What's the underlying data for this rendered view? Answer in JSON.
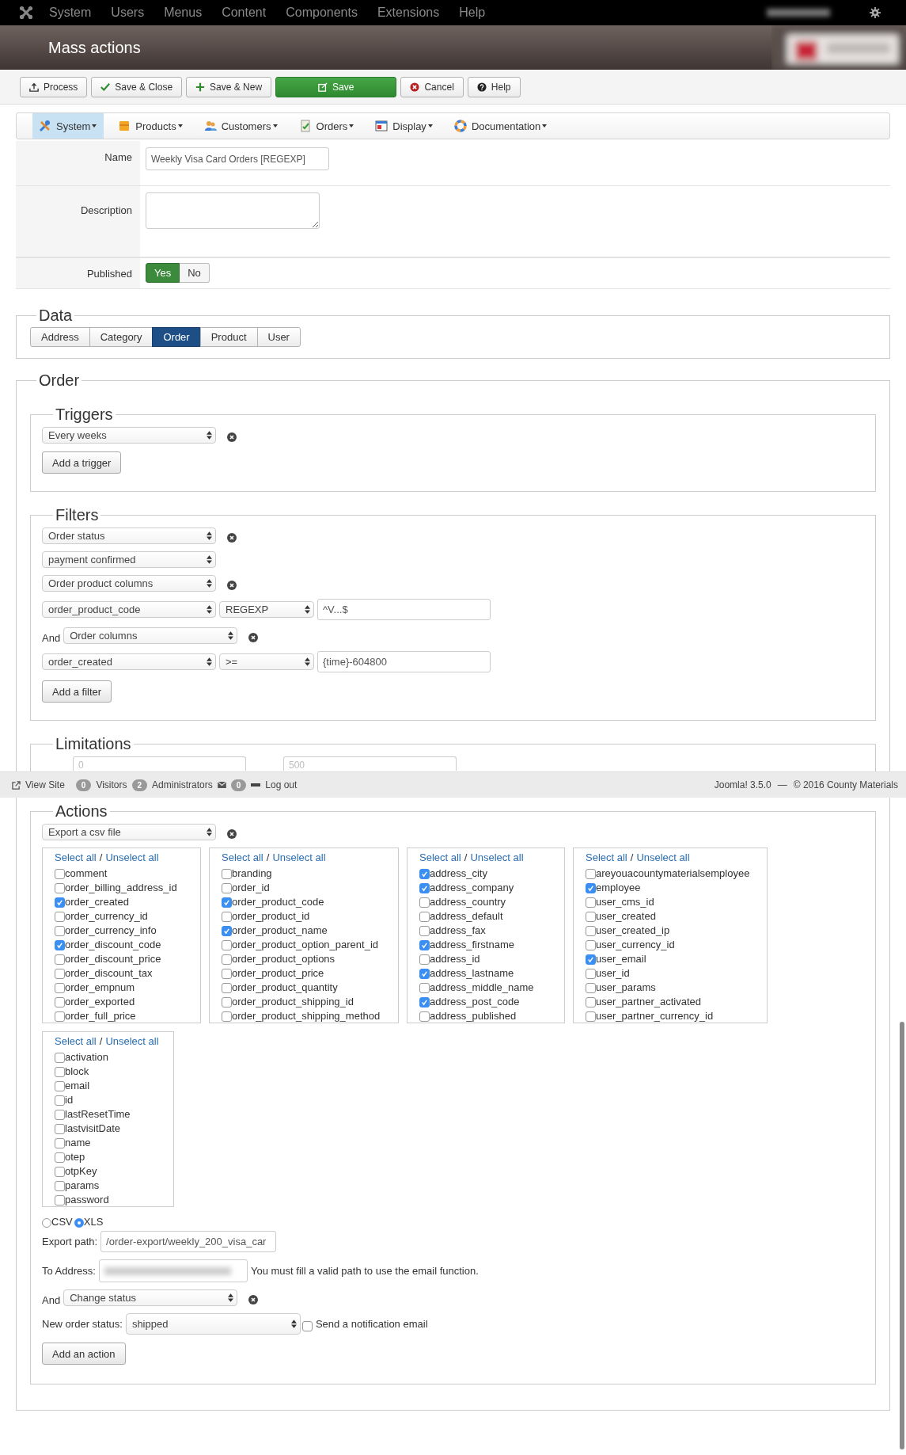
{
  "top_menu": {
    "items": [
      "System",
      "Users",
      "Menus",
      "Content",
      "Components",
      "Extensions",
      "Help"
    ]
  },
  "header": {
    "title": "Mass actions"
  },
  "toolbar": {
    "buttons": [
      {
        "label": "Process",
        "primary": false
      },
      {
        "label": "Save & Close",
        "primary": false
      },
      {
        "label": "Save & New",
        "primary": false
      },
      {
        "label": "Save",
        "primary": true
      },
      {
        "label": "Cancel",
        "primary": false
      },
      {
        "label": "Help",
        "primary": false
      }
    ]
  },
  "submenu": {
    "items": [
      {
        "label": "System",
        "selected": true
      },
      {
        "label": "Products",
        "selected": false
      },
      {
        "label": "Customers",
        "selected": false
      },
      {
        "label": "Orders",
        "selected": false
      },
      {
        "label": "Display",
        "selected": false
      },
      {
        "label": "Documentation",
        "selected": false
      }
    ]
  },
  "form": {
    "name": {
      "label": "Name",
      "value": "Weekly Visa Card Orders [REGEXP]"
    },
    "description": {
      "label": "Description"
    },
    "published": {
      "label": "Published",
      "options": [
        {
          "label": "Yes",
          "selected": true
        },
        {
          "label": "No",
          "selected": false
        }
      ]
    }
  },
  "data": {
    "legend": "Data",
    "tabs": [
      {
        "label": "Address",
        "selected": false
      },
      {
        "label": "Category",
        "selected": false
      },
      {
        "label": "Order",
        "selected": true
      },
      {
        "label": "Product",
        "selected": false
      },
      {
        "label": "User",
        "selected": false
      }
    ]
  },
  "order": {
    "legend": "Order",
    "triggers": {
      "legend": "Triggers",
      "rows": [
        [
          {
            "kind": "select",
            "text": "Every weeks"
          },
          {
            "kind": "remove"
          }
        ]
      ],
      "add_button": "Add a trigger"
    },
    "filters": {
      "legend": "Filters",
      "rows": [
        {
          "controls": [
            {
              "kind": "select",
              "text": "Order status"
            },
            {
              "kind": "remove"
            }
          ]
        },
        {
          "controls": [
            {
              "kind": "select",
              "text": "payment confirmed"
            }
          ]
        },
        {
          "controls": [
            {
              "kind": "select",
              "text": "Order product columns"
            },
            {
              "kind": "remove"
            }
          ]
        },
        {
          "controls": [
            {
              "kind": "select",
              "text": "order_product_code"
            },
            {
              "kind": "operator",
              "text": "REGEXP"
            },
            {
              "kind": "input",
              "text": "^V...$"
            }
          ]
        },
        {
          "prefix": "And",
          "controls": [
            {
              "kind": "select",
              "text": "Order columns"
            },
            {
              "kind": "remove"
            }
          ]
        },
        {
          "controls": [
            {
              "kind": "select",
              "text": "order_created"
            },
            {
              "kind": "operator",
              "text": ">="
            },
            {
              "kind": "input",
              "text": "{time}-604800"
            }
          ]
        }
      ],
      "add_button": "Add a filter"
    },
    "limitations": {
      "legend": "Limitations",
      "fields": [
        {
          "placeholder": "0"
        },
        {
          "placeholder": "500"
        }
      ]
    },
    "actions": {
      "legend": "Actions",
      "export_row": [
        {
          "kind": "select",
          "text": "Export a csv file"
        },
        {
          "kind": "remove"
        }
      ],
      "lists": [
        {
          "select_all": "Select all",
          "divider": "/",
          "unselect_all": "Unselect all",
          "fields": [
            {
              "label": "comment",
              "checked": false
            },
            {
              "label": "order_billing_address_id",
              "checked": false
            },
            {
              "label": "order_created",
              "checked": true
            },
            {
              "label": "order_currency_id",
              "checked": false
            },
            {
              "label": "order_currency_info",
              "checked": false
            },
            {
              "label": "order_discount_code",
              "checked": true
            },
            {
              "label": "order_discount_price",
              "checked": false
            },
            {
              "label": "order_discount_tax",
              "checked": false
            },
            {
              "label": "order_empnum",
              "checked": false
            },
            {
              "label": "order_exported",
              "checked": false
            },
            {
              "label": "order_full_price",
              "checked": false
            }
          ]
        },
        {
          "select_all": "Select all",
          "divider": "/",
          "unselect_all": "Unselect all",
          "fields": [
            {
              "label": "branding",
              "checked": false
            },
            {
              "label": "order_id",
              "checked": false
            },
            {
              "label": "order_product_code",
              "checked": true
            },
            {
              "label": "order_product_id",
              "checked": false
            },
            {
              "label": "order_product_name",
              "checked": true
            },
            {
              "label": "order_product_option_parent_id",
              "checked": false
            },
            {
              "label": "order_product_options",
              "checked": false
            },
            {
              "label": "order_product_price",
              "checked": false
            },
            {
              "label": "order_product_quantity",
              "checked": false
            },
            {
              "label": "order_product_shipping_id",
              "checked": false
            },
            {
              "label": "order_product_shipping_method",
              "checked": false
            }
          ]
        },
        {
          "select_all": "Select all",
          "divider": "/",
          "unselect_all": "Unselect all",
          "fields": [
            {
              "label": "address_city",
              "checked": true
            },
            {
              "label": "address_company",
              "checked": true
            },
            {
              "label": "address_country",
              "checked": false
            },
            {
              "label": "address_default",
              "checked": false
            },
            {
              "label": "address_fax",
              "checked": false
            },
            {
              "label": "address_firstname",
              "checked": true
            },
            {
              "label": "address_id",
              "checked": false
            },
            {
              "label": "address_lastname",
              "checked": true
            },
            {
              "label": "address_middle_name",
              "checked": false
            },
            {
              "label": "address_post_code",
              "checked": true
            },
            {
              "label": "address_published",
              "checked": false
            }
          ]
        },
        {
          "select_all": "Select all",
          "divider": "/",
          "unselect_all": "Unselect all",
          "fields": [
            {
              "label": "areyouacountymaterialsemployee",
              "checked": false
            },
            {
              "label": "employee",
              "checked": true
            },
            {
              "label": "user_cms_id",
              "checked": false
            },
            {
              "label": "user_created",
              "checked": false
            },
            {
              "label": "user_created_ip",
              "checked": false
            },
            {
              "label": "user_currency_id",
              "checked": false
            },
            {
              "label": "user_email",
              "checked": true
            },
            {
              "label": "user_id",
              "checked": false
            },
            {
              "label": "user_params",
              "checked": false
            },
            {
              "label": "user_partner_activated",
              "checked": false
            },
            {
              "label": "user_partner_currency_id",
              "checked": false
            }
          ]
        },
        {
          "select_all": "Select all",
          "divider": "/",
          "unselect_all": "Unselect all",
          "fields": [
            {
              "label": "activation",
              "checked": false
            },
            {
              "label": "block",
              "checked": false
            },
            {
              "label": "email",
              "checked": false
            },
            {
              "label": "id",
              "checked": false
            },
            {
              "label": "lastResetTime",
              "checked": false
            },
            {
              "label": "lastvisitDate",
              "checked": false
            },
            {
              "label": "name",
              "checked": false
            },
            {
              "label": "otep",
              "checked": false
            },
            {
              "label": "otpKey",
              "checked": false
            },
            {
              "label": "params",
              "checked": false
            },
            {
              "label": "password",
              "checked": false
            }
          ]
        }
      ],
      "format": [
        {
          "label": "CSV",
          "selected": false
        },
        {
          "label": "XLS",
          "selected": true
        }
      ],
      "export_path": {
        "label": "Export path:",
        "value": "/order-export/weekly_200_visa_car"
      },
      "to_address": {
        "label": "To Address:",
        "note": "You must fill a valid path to use the email function."
      },
      "status_row": {
        "prefix": "And",
        "controls": [
          {
            "kind": "select",
            "text": "Change status"
          },
          {
            "kind": "remove"
          }
        ]
      },
      "new_status": {
        "label": "New order status:",
        "value": "shipped"
      },
      "notify": {
        "label": "Send a notification email",
        "checked": false
      },
      "add_button": "Add an action"
    }
  },
  "status_bar": {
    "view_site": "View Site",
    "visitors_count": "0",
    "visitors": "Visitors",
    "admins_count": "2",
    "admins": "Administrators",
    "messages_count": "0",
    "logout": "Log out",
    "version": "Joomla! 3.5.0",
    "separator": "—",
    "copyright": "© 2016 County Materials"
  }
}
